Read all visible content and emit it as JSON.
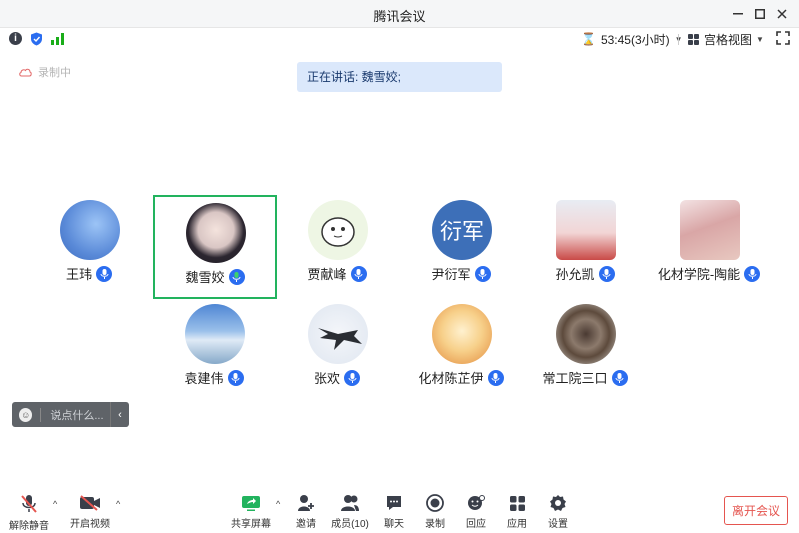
{
  "window": {
    "title": "腾讯会议"
  },
  "status": {
    "timer": "53:45(3小时)",
    "view_label": "宫格视图"
  },
  "recording": {
    "label": "录制中"
  },
  "speaking": {
    "text": "正在讲话: 魏雪姣;"
  },
  "participants": [
    {
      "name": "王玮",
      "avatar": "sky-photo",
      "active": false
    },
    {
      "name": "魏雪姣",
      "avatar": "anime-girl",
      "active": true
    },
    {
      "name": "贾献峰",
      "avatar": "cartoon-bird",
      "active": false
    },
    {
      "name": "尹衍军",
      "avatar_text": "衍军",
      "active": false
    },
    {
      "name": "孙允凯",
      "avatar": "banner-photo",
      "active": false
    },
    {
      "name": "化材学院-陶能",
      "avatar": "family-photo",
      "active": false
    },
    {
      "name": "袁建伟",
      "avatar": "earth-photo",
      "active": false
    },
    {
      "name": "张欢",
      "avatar": "fighter-jet",
      "active": false
    },
    {
      "name": "化材陈芷伊",
      "avatar": "flower-art",
      "active": false
    },
    {
      "name": "常工院三口",
      "avatar": "wheel-photo",
      "active": false
    }
  ],
  "chat": {
    "placeholder": "说点什么..."
  },
  "toolbar": {
    "unmute": "解除静音",
    "start_video": "开启视频",
    "share_screen": "共享屏幕",
    "invite": "邀请",
    "members": "成员(10)",
    "chat": "聊天",
    "record": "录制",
    "react": "回应",
    "apps": "应用",
    "settings": "设置",
    "leave": "离开会议"
  },
  "colors": {
    "accent": "#2b6df0",
    "active_border": "#22b35e",
    "leave": "#e5554f",
    "share_green": "#22b35e"
  }
}
